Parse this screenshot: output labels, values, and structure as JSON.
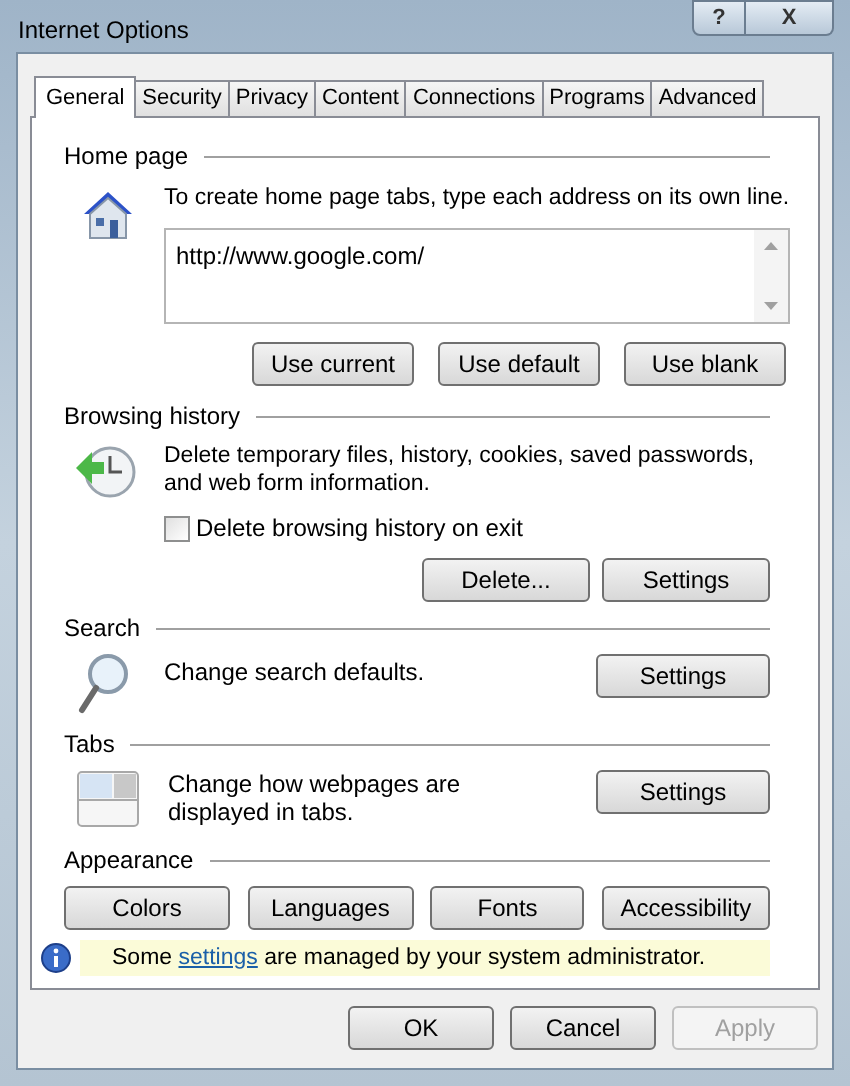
{
  "window": {
    "title": "Internet Options",
    "controls": [
      "?",
      "X"
    ]
  },
  "tabs": [
    {
      "label": "General",
      "selected": true
    },
    {
      "label": "Security",
      "selected": false
    },
    {
      "label": "Privacy",
      "selected": false
    },
    {
      "label": "Content",
      "selected": false
    },
    {
      "label": "Connections",
      "selected": false
    },
    {
      "label": "Programs",
      "selected": false
    },
    {
      "label": "Advanced",
      "selected": false
    }
  ],
  "home_page": {
    "heading": "Home page",
    "description": "To create home page tabs, type each address on its own line.",
    "value": "http://www.google.com/",
    "buttons": [
      "Use current",
      "Use default",
      "Use blank"
    ]
  },
  "browsing_history": {
    "heading": "Browsing history",
    "description": "Delete temporary files, history, cookies, saved passwords, and web form information.",
    "checkbox": {
      "label": "Delete browsing history on exit",
      "checked": false
    },
    "buttons": [
      "Delete...",
      "Settings"
    ]
  },
  "search": {
    "heading": "Search",
    "description": "Change search defaults.",
    "button": "Settings"
  },
  "tabs_section": {
    "heading": "Tabs",
    "description": "Change how webpages are displayed in tabs.",
    "button": "Settings"
  },
  "appearance": {
    "heading": "Appearance",
    "buttons": [
      "Colors",
      "Languages",
      "Fonts",
      "Accessibility"
    ]
  },
  "info_bar": {
    "before": "Some ",
    "link": "settings",
    "after": " are managed by your system administrator."
  },
  "dialog_buttons": [
    {
      "label": "OK",
      "disabled": false
    },
    {
      "label": "Cancel",
      "disabled": false
    },
    {
      "label": "Apply",
      "disabled": true
    }
  ]
}
